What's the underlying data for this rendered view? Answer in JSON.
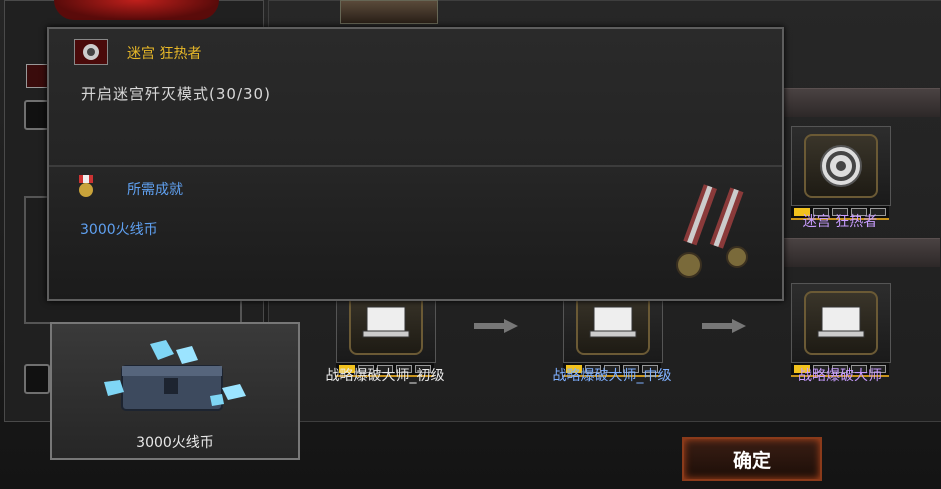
{
  "tooltip": {
    "title": "迷宫 狂热者",
    "description": "开启迷宫歼灭模式(30/30)",
    "required_label": "所需成就",
    "required_value": "3000火线币"
  },
  "reward": {
    "label": "3000火线币"
  },
  "achievements": [
    {
      "label": "迷宫 狂热者",
      "color": "#c89cff",
      "level": 1,
      "pips": 5
    },
    {
      "label": "战略爆破大师_初级",
      "color": "#e8e8e8",
      "level": 1,
      "pips": 5
    },
    {
      "label": "战略爆破大师_中级",
      "color": "#7fb0ff",
      "level": 1,
      "pips": 5
    },
    {
      "label": "战略爆破大师",
      "color": "#c89cff",
      "level": 1,
      "pips": 5
    }
  ],
  "confirm_button": "确定",
  "colors": {
    "title_gold": "#e8b828",
    "description": "#d8d8d8",
    "required_blue": "#5fa0f0",
    "button_border": "#8a3a1a"
  },
  "icons": [
    "maze-badge-icon",
    "medal-icon",
    "chest-icon",
    "arrow-right-icon"
  ]
}
